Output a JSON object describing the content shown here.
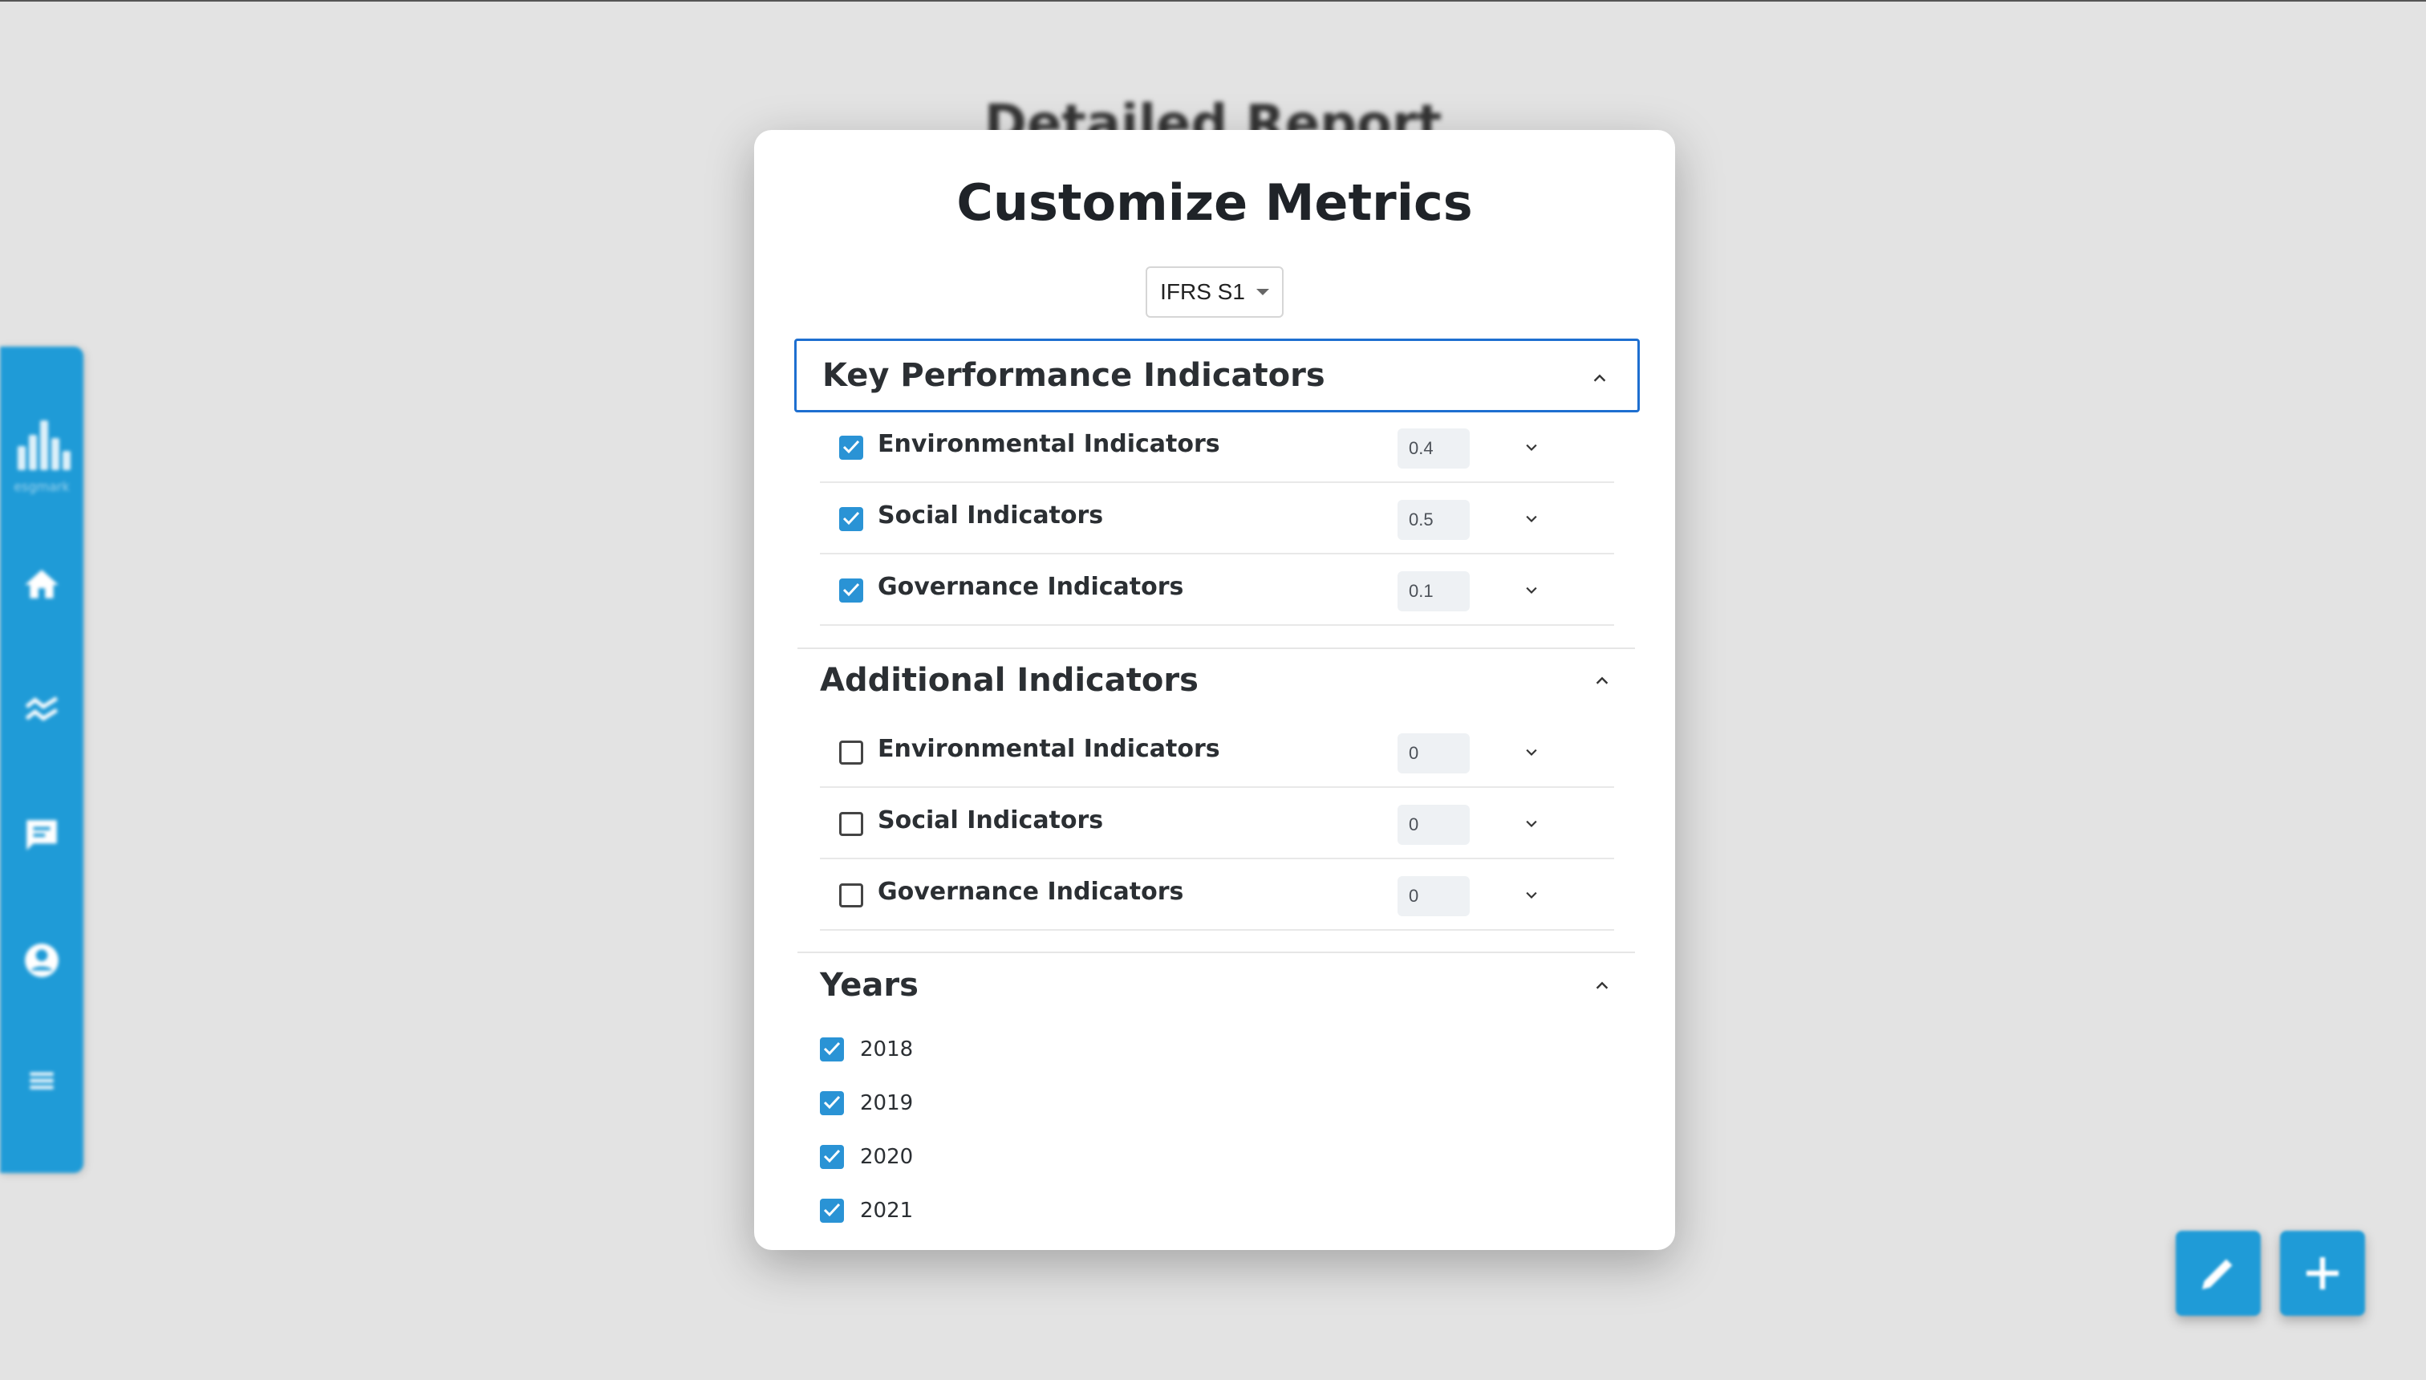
{
  "background": {
    "page_title": "Detailed Report",
    "brand_color": "#1f9bd7"
  },
  "sidebar": {
    "logo_text": "esgmark",
    "icons": [
      "bar-chart-logo-icon",
      "home-icon",
      "trend-icon",
      "chat-icon",
      "account-icon",
      "menu-icon"
    ]
  },
  "modal": {
    "title": "Customize Metrics",
    "standard_select": {
      "value": "IFRS S1"
    },
    "sections": {
      "kpi": {
        "title": "Key Performance Indicators",
        "rows": [
          {
            "label": "Environmental Indicators",
            "checked": true,
            "weight": "0.4"
          },
          {
            "label": "Social Indicators",
            "checked": true,
            "weight": "0.5"
          },
          {
            "label": "Governance Indicators",
            "checked": true,
            "weight": "0.1"
          }
        ]
      },
      "additional": {
        "title": "Additional Indicators",
        "rows": [
          {
            "label": "Environmental Indicators",
            "checked": false,
            "weight": "0"
          },
          {
            "label": "Social Indicators",
            "checked": false,
            "weight": "0"
          },
          {
            "label": "Governance Indicators",
            "checked": false,
            "weight": "0"
          }
        ]
      },
      "years": {
        "title": "Years",
        "items": [
          {
            "label": "2018",
            "checked": true
          },
          {
            "label": "2019",
            "checked": true
          },
          {
            "label": "2020",
            "checked": true
          },
          {
            "label": "2021",
            "checked": true
          }
        ]
      }
    }
  },
  "fabs": [
    "edit-icon",
    "plus-icon"
  ],
  "colors": {
    "accent": "#2a93d5",
    "focus": "#1e6fd0"
  }
}
